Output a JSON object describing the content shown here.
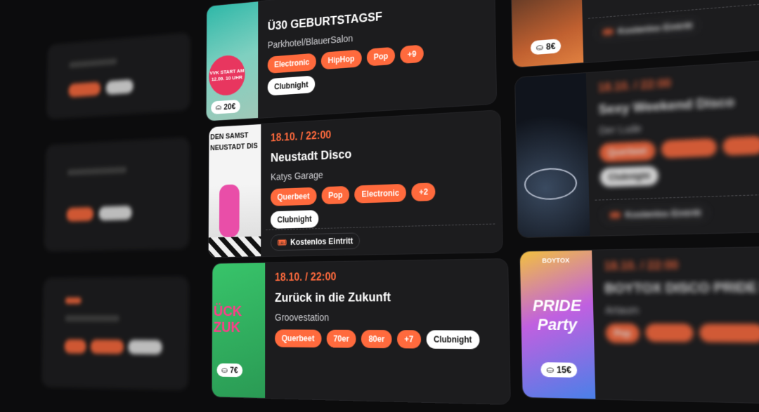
{
  "cards": {
    "top": {
      "title": "Ü30 GEBURTSTAGSF",
      "venue": "Parkhotel/BlauerSalon",
      "tags": [
        "Electronic",
        "HipHop",
        "Pop",
        "+9"
      ],
      "extra_tag": "Clubnight",
      "price": "20€",
      "poster_text": "VVK START AM 12.09. 10 UHR"
    },
    "middle": {
      "date": "18.10. / 22:00",
      "title": "Neustadt Disco",
      "venue": "Katys Garage",
      "tags": [
        "Querbeet",
        "Pop",
        "Electronic",
        "+2"
      ],
      "extra_tag": "Clubnight",
      "ticket": "Kostenlos Eintritt",
      "poster_text": "DEN SAMST NEUSTADT DIS"
    },
    "bottom": {
      "date": "18.10. / 22:00",
      "title": "Zurück in die Zukunft",
      "venue": "Groovestation",
      "tags": [
        "Querbeet",
        "70er",
        "80er",
        "+7"
      ],
      "extra_tag": "Clubnight",
      "price": "7€",
      "poster_text": "ÜCK ZUK"
    },
    "right_top": {
      "price": "8€",
      "ticket": "Kostenlos Eintritt"
    },
    "right_middle": {
      "date": "18.10. / 22:00",
      "title": "Sexy Weekend Disco",
      "venue": "Der Lude",
      "tags": [
        "Querbeet",
        "",
        ""
      ],
      "extra_tag": "Clubnight",
      "ticket": "Kostenlos Eintritt"
    },
    "right_bottom": {
      "date": "18.10. / 22:00",
      "title": "BOYTOX DISCO PRIDE PARTY",
      "venue": "Artaum",
      "tags": [
        "Pop",
        "",
        ""
      ],
      "price": "15€",
      "poster_text": "PRIDE Party",
      "poster_top": "BOYTOX"
    }
  },
  "colors": {
    "accent": "#ff6a3d",
    "card": "#1c1c1e",
    "bg": "#0c0c0d"
  }
}
